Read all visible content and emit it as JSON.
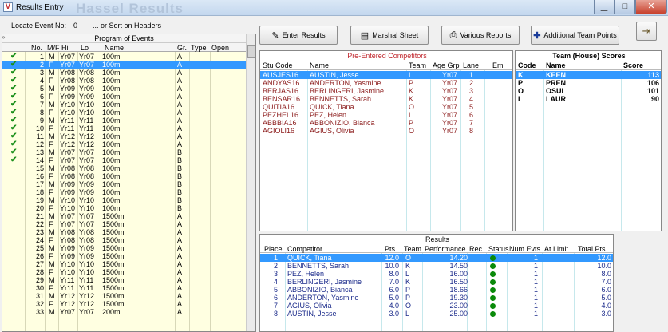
{
  "window": {
    "title": "Results Entry",
    "ghost_title": "Hassel Results"
  },
  "locate": {
    "label": "Locate Event No:",
    "value": "0",
    "sort_hint": "... or Sort on Headers"
  },
  "toolbar": {
    "enter_results": "Enter Results",
    "marshal_sheet": "Marshal Sheet",
    "various_reports": "Various Reports",
    "additional_team_points": "Additional Team Points"
  },
  "program": {
    "title": "Program of Events",
    "headers": {
      "no": "No.",
      "mf": "M/F",
      "hi": "Hi",
      "lo": "Lo",
      "name": "Name",
      "gr": "Gr.",
      "type": "Type",
      "open": "Open"
    },
    "rows": [
      {
        "chk": "✔",
        "no": "1",
        "mf": "M",
        "hi": "Yr07",
        "lo": "Yr07",
        "name": "100m",
        "gr": "A"
      },
      {
        "chk": "✔",
        "no": "2",
        "mf": "F",
        "hi": "Yr07",
        "lo": "Yr07",
        "name": "100m",
        "gr": "A"
      },
      {
        "chk": "✔",
        "no": "3",
        "mf": "M",
        "hi": "Yr08",
        "lo": "Yr08",
        "name": "100m",
        "gr": "A"
      },
      {
        "chk": "✔",
        "no": "4",
        "mf": "F",
        "hi": "Yr08",
        "lo": "Yr08",
        "name": "100m",
        "gr": "A"
      },
      {
        "chk": "✔",
        "no": "5",
        "mf": "M",
        "hi": "Yr09",
        "lo": "Yr09",
        "name": "100m",
        "gr": "A"
      },
      {
        "chk": "✔",
        "no": "6",
        "mf": "F",
        "hi": "Yr09",
        "lo": "Yr09",
        "name": "100m",
        "gr": "A"
      },
      {
        "chk": "✔",
        "no": "7",
        "mf": "M",
        "hi": "Yr10",
        "lo": "Yr10",
        "name": "100m",
        "gr": "A"
      },
      {
        "chk": "✔",
        "no": "8",
        "mf": "F",
        "hi": "Yr10",
        "lo": "Yr10",
        "name": "100m",
        "gr": "A"
      },
      {
        "chk": "✔",
        "no": "9",
        "mf": "M",
        "hi": "Yr11",
        "lo": "Yr11",
        "name": "100m",
        "gr": "A"
      },
      {
        "chk": "✔",
        "no": "10",
        "mf": "F",
        "hi": "Yr11",
        "lo": "Yr11",
        "name": "100m",
        "gr": "A"
      },
      {
        "chk": "✔",
        "no": "11",
        "mf": "M",
        "hi": "Yr12",
        "lo": "Yr12",
        "name": "100m",
        "gr": "A"
      },
      {
        "chk": "✔",
        "no": "12",
        "mf": "F",
        "hi": "Yr12",
        "lo": "Yr12",
        "name": "100m",
        "gr": "A"
      },
      {
        "chk": "✔",
        "no": "13",
        "mf": "M",
        "hi": "Yr07",
        "lo": "Yr07",
        "name": "100m",
        "gr": "B"
      },
      {
        "chk": "✔",
        "no": "14",
        "mf": "F",
        "hi": "Yr07",
        "lo": "Yr07",
        "name": "100m",
        "gr": "B"
      },
      {
        "chk": "",
        "no": "15",
        "mf": "M",
        "hi": "Yr08",
        "lo": "Yr08",
        "name": "100m",
        "gr": "B"
      },
      {
        "chk": "",
        "no": "16",
        "mf": "F",
        "hi": "Yr08",
        "lo": "Yr08",
        "name": "100m",
        "gr": "B"
      },
      {
        "chk": "",
        "no": "17",
        "mf": "M",
        "hi": "Yr09",
        "lo": "Yr09",
        "name": "100m",
        "gr": "B"
      },
      {
        "chk": "",
        "no": "18",
        "mf": "F",
        "hi": "Yr09",
        "lo": "Yr09",
        "name": "100m",
        "gr": "B"
      },
      {
        "chk": "",
        "no": "19",
        "mf": "M",
        "hi": "Yr10",
        "lo": "Yr10",
        "name": "100m",
        "gr": "B"
      },
      {
        "chk": "",
        "no": "20",
        "mf": "F",
        "hi": "Yr10",
        "lo": "Yr10",
        "name": "100m",
        "gr": "B"
      },
      {
        "chk": "",
        "no": "21",
        "mf": "M",
        "hi": "Yr07",
        "lo": "Yr07",
        "name": "1500m",
        "gr": "A"
      },
      {
        "chk": "",
        "no": "22",
        "mf": "F",
        "hi": "Yr07",
        "lo": "Yr07",
        "name": "1500m",
        "gr": "A"
      },
      {
        "chk": "",
        "no": "23",
        "mf": "M",
        "hi": "Yr08",
        "lo": "Yr08",
        "name": "1500m",
        "gr": "A"
      },
      {
        "chk": "",
        "no": "24",
        "mf": "F",
        "hi": "Yr08",
        "lo": "Yr08",
        "name": "1500m",
        "gr": "A"
      },
      {
        "chk": "",
        "no": "25",
        "mf": "M",
        "hi": "Yr09",
        "lo": "Yr09",
        "name": "1500m",
        "gr": "A"
      },
      {
        "chk": "",
        "no": "26",
        "mf": "F",
        "hi": "Yr09",
        "lo": "Yr09",
        "name": "1500m",
        "gr": "A"
      },
      {
        "chk": "",
        "no": "27",
        "mf": "M",
        "hi": "Yr10",
        "lo": "Yr10",
        "name": "1500m",
        "gr": "A"
      },
      {
        "chk": "",
        "no": "28",
        "mf": "F",
        "hi": "Yr10",
        "lo": "Yr10",
        "name": "1500m",
        "gr": "A"
      },
      {
        "chk": "",
        "no": "29",
        "mf": "M",
        "hi": "Yr11",
        "lo": "Yr11",
        "name": "1500m",
        "gr": "A"
      },
      {
        "chk": "",
        "no": "30",
        "mf": "F",
        "hi": "Yr11",
        "lo": "Yr11",
        "name": "1500m",
        "gr": "A"
      },
      {
        "chk": "",
        "no": "31",
        "mf": "M",
        "hi": "Yr12",
        "lo": "Yr12",
        "name": "1500m",
        "gr": "A"
      },
      {
        "chk": "",
        "no": "32",
        "mf": "F",
        "hi": "Yr12",
        "lo": "Yr12",
        "name": "1500m",
        "gr": "A"
      },
      {
        "chk": "",
        "no": "33",
        "mf": "M",
        "hi": "Yr07",
        "lo": "Yr07",
        "name": "200m",
        "gr": "A"
      }
    ]
  },
  "pre_entered": {
    "title": "Pre-Entered Competitors",
    "headers": {
      "code": "Stu Code",
      "name": "Name",
      "team": "Team",
      "age": "Age Grp",
      "lane": "Lane",
      "em": "Em"
    },
    "rows": [
      {
        "code": "AUSJES16",
        "name": "AUSTIN, Jesse",
        "team": "L",
        "age": "Yr07",
        "lane": "1"
      },
      {
        "code": "ANDYAS16",
        "name": "ANDERTON, Yasmine",
        "team": "P",
        "age": "Yr07",
        "lane": "2"
      },
      {
        "code": "BERJAS16",
        "name": "BERLINGERI, Jasmine",
        "team": "K",
        "age": "Yr07",
        "lane": "3"
      },
      {
        "code": "BENSAR16",
        "name": "BENNETTS, Sarah",
        "team": "K",
        "age": "Yr07",
        "lane": "4"
      },
      {
        "code": "QUITIA16",
        "name": "QUICK, Tiana",
        "team": "O",
        "age": "Yr07",
        "lane": "5"
      },
      {
        "code": "PEZHEL16",
        "name": "PEZ, Helen",
        "team": "L",
        "age": "Yr07",
        "lane": "6"
      },
      {
        "code": "ABBBIA16",
        "name": "ABBONIZIO, Bianca",
        "team": "P",
        "age": "Yr07",
        "lane": "7"
      },
      {
        "code": "AGIOLI16",
        "name": "AGIUS, Olivia",
        "team": "O",
        "age": "Yr07",
        "lane": "8"
      }
    ]
  },
  "team_scores": {
    "title": "Team (House) Scores",
    "headers": {
      "code": "Code",
      "name": "Name",
      "score": "Score"
    },
    "rows": [
      {
        "code": "K",
        "name": "KEEN",
        "score": "113"
      },
      {
        "code": "P",
        "name": "PREN",
        "score": "106"
      },
      {
        "code": "O",
        "name": "OSUL",
        "score": "101"
      },
      {
        "code": "L",
        "name": "LAUR",
        "score": "90"
      }
    ]
  },
  "results": {
    "title": "Results",
    "headers": {
      "place": "Place",
      "competitor": "Competitor",
      "pts": "Pts",
      "team": "Team",
      "perf": "Performance",
      "rec": "Rec",
      "status": "Status",
      "num_evts": "Num Evts",
      "limit": "At Limit",
      "total": "Total Pts"
    },
    "rows": [
      {
        "place": "1",
        "comp": "QUICK, Tiana",
        "pts": "12.0",
        "team": "O",
        "perf": "14.20",
        "num": "1",
        "tot": "12.0"
      },
      {
        "place": "2",
        "comp": "BENNETTS, Sarah",
        "pts": "10.0",
        "team": "K",
        "perf": "14.50",
        "num": "1",
        "tot": "10.0"
      },
      {
        "place": "3",
        "comp": "PEZ, Helen",
        "pts": "8.0",
        "team": "L",
        "perf": "16.00",
        "num": "1",
        "tot": "8.0"
      },
      {
        "place": "4",
        "comp": "BERLINGERI, Jasmine",
        "pts": "7.0",
        "team": "K",
        "perf": "16.50",
        "num": "1",
        "tot": "7.0"
      },
      {
        "place": "5",
        "comp": "ABBONIZIO, Bianca",
        "pts": "6.0",
        "team": "P",
        "perf": "18.66",
        "num": "1",
        "tot": "6.0"
      },
      {
        "place": "6",
        "comp": "ANDERTON, Yasmine",
        "pts": "5.0",
        "team": "P",
        "perf": "19.30",
        "num": "1",
        "tot": "5.0"
      },
      {
        "place": "7",
        "comp": "AGIUS, Olivia",
        "pts": "4.0",
        "team": "O",
        "perf": "23.00",
        "num": "1",
        "tot": "4.0"
      },
      {
        "place": "8",
        "comp": "AUSTIN, Jesse",
        "pts": "3.0",
        "team": "L",
        "perf": "25.00",
        "num": "1",
        "tot": "3.0"
      }
    ]
  },
  "colors": {
    "selection": "#3399ff",
    "check": "#1a8f1a",
    "pre_text": "#8b1a1a",
    "result_text": "#1a2a8a",
    "status_ok": "#0a8a0a"
  }
}
